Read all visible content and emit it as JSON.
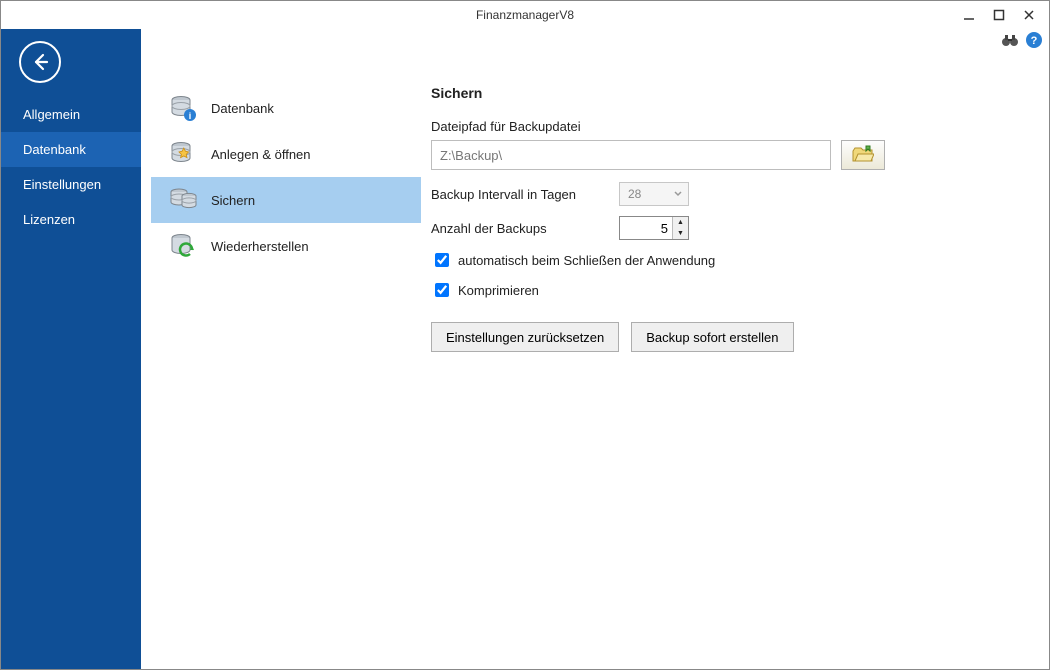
{
  "window": {
    "title": "FinanzmanagerV8"
  },
  "sidebar": {
    "items": [
      {
        "label": "Allgemein"
      },
      {
        "label": "Datenbank",
        "active": true
      },
      {
        "label": "Einstellungen"
      },
      {
        "label": "Lizenzen"
      }
    ]
  },
  "subnav": {
    "items": [
      {
        "label": "Datenbank"
      },
      {
        "label": "Anlegen & öffnen"
      },
      {
        "label": "Sichern",
        "active": true
      },
      {
        "label": "Wiederherstellen"
      }
    ]
  },
  "panel": {
    "title": "Sichern",
    "path_label": "Dateipfad für Backupdatei",
    "path_value": "Z:\\Backup\\",
    "interval_label": "Backup Intervall in Tagen",
    "interval_value": "28",
    "count_label": "Anzahl der Backups",
    "count_value": "5",
    "auto_close_label": "automatisch beim Schließen der Anwendung",
    "compress_label": "Komprimieren",
    "reset_button": "Einstellungen zurücksetzen",
    "backup_now_button": "Backup sofort erstellen"
  }
}
